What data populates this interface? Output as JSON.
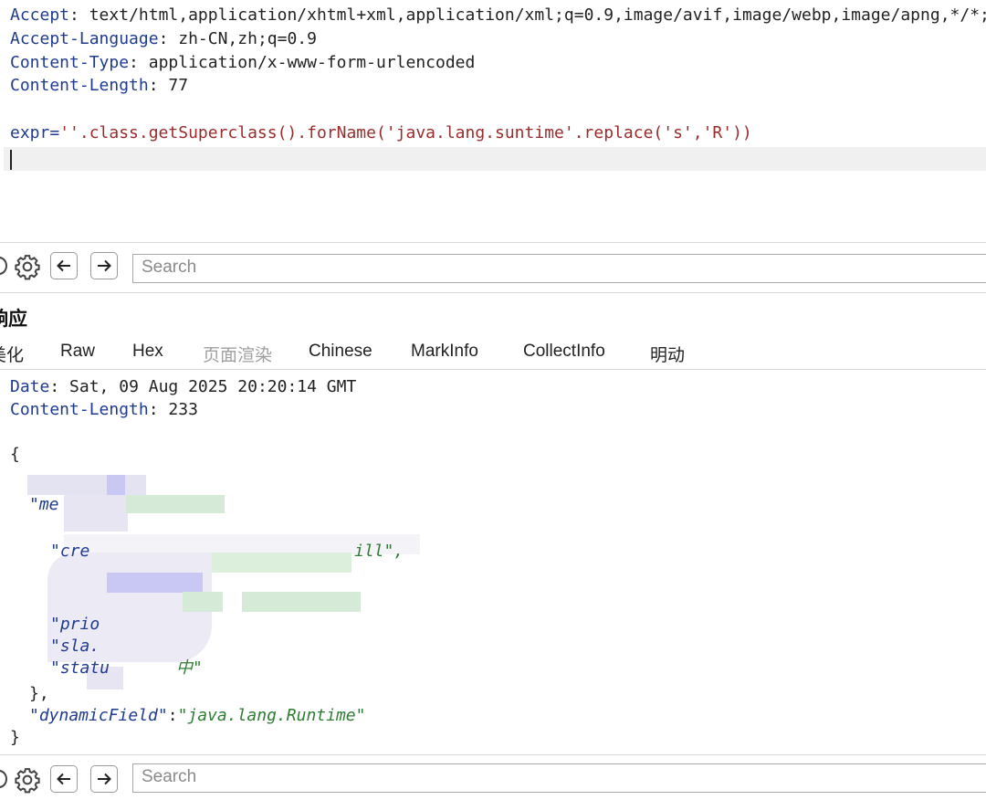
{
  "request": {
    "headers": [
      {
        "key": "Accept",
        "value": "text/html,application/xhtml+xml,application/xml;q=0.9,image/avif,image/webp,image/apng,*/*;"
      },
      {
        "key": "Accept-Language",
        "value": "zh-CN,zh;q=0.9"
      },
      {
        "key": "Content-Type",
        "value": "application/x-www-form-urlencoded"
      },
      {
        "key": "Content-Length",
        "value": "77"
      }
    ],
    "body_param": "expr=",
    "body_value": "''.class.getSuperclass().forName('java.lang.suntime'.replace('s','R'))"
  },
  "toolbar": {
    "search_placeholder": "Search"
  },
  "response": {
    "title": "响应",
    "tabs": [
      {
        "label": "美化",
        "active": true
      },
      {
        "label": "Raw",
        "active": false
      },
      {
        "label": "Hex",
        "active": false
      },
      {
        "label": "页面渲染",
        "active": false,
        "disabled": true
      },
      {
        "label": "Chinese",
        "active": false
      },
      {
        "label": "MarkInfo",
        "active": false
      },
      {
        "label": "CollectInfo",
        "active": false
      },
      {
        "label": "明动",
        "active": false
      }
    ],
    "headers": [
      {
        "key": "Date",
        "value": "Sat, 09 Aug 2025 20:20:14 GMT"
      },
      {
        "key": "Content-Length",
        "value": "233"
      }
    ],
    "fragments": {
      "open_brace": "{",
      "me": "\"me",
      "cre": "\"cre",
      "cre_tail": "ill\",",
      "prio": "\"prio",
      "sla": "\"sla.",
      "statu": "\"statu",
      "statu_tail": "中\"",
      "obj_close": "},"
    },
    "dynamic_key": "\"dynamicField\"",
    "dynamic_colon": ":",
    "dynamic_value": "\"java.lang.Runtime\"",
    "close_brace": "}"
  },
  "colors": {
    "key": "#1f3b8f",
    "string": "#2e7d32",
    "request_string": "#9a2b2b",
    "blur_purple": "#d7d5ee",
    "blur_green": "#d6ead8"
  }
}
